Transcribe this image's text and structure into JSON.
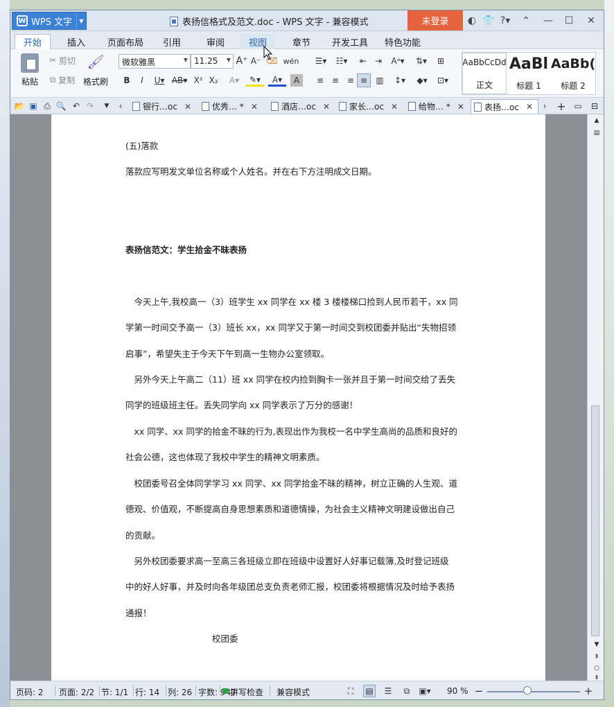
{
  "titlebar": {
    "app_name": "WPS 文字",
    "document_title": "表扬信格式及范文.doc - WPS 文字 - 兼容模式",
    "login": "未登录"
  },
  "menu": {
    "tabs": [
      "开始",
      "插入",
      "页面布局",
      "引用",
      "审阅",
      "视图",
      "章节",
      "开发工具",
      "特色功能"
    ]
  },
  "ribbon": {
    "paste": "粘贴",
    "cut": "剪切",
    "copy": "复制",
    "format_painter": "格式刷",
    "font_name": "微软雅黑",
    "font_size": "11.25",
    "styles": [
      {
        "preview": "AaBbCcDd",
        "name": "正文"
      },
      {
        "preview": "AaBl",
        "name": "标题 1"
      },
      {
        "preview": "AaBb(",
        "name": "标题 2"
      }
    ]
  },
  "doc_tabs": [
    "银行…oc",
    "优秀… *",
    "酒店…oc",
    "家长…oc",
    "给物… *",
    "表扬…oc"
  ],
  "document": {
    "lines": [
      "(五)落款",
      "落款应写明发文单位名称或个人姓名。并在右下方注明成文日期。",
      "表扬信范文：学生拾金不昧表扬",
      "　今天上午,我校高一（3）班学生 xx 同学在 xx 楼 3 楼楼梯口捡到人民币若干，xx 同",
      "学第一时间交予高一（3）班长 xx，xx 同学又于第一时间交到校团委并贴出“失物招领",
      "启事”，希望失主于今天下午到高一生物办公室领取。",
      "　另外今天上午高二（11）班 xx 同学在校内捡到胸卡一张并且于第一时间交给了丢失",
      "同学的班级班主任。丢失同学向 xx 同学表示了万分的感谢！",
      "　xx 同学、xx 同学的拾金不昧的行为,表现出作为我校一名中学生高尚的品质和良好的",
      "社会公德，这也体现了我校中学生的精神文明素质。",
      "　校团委号召全体同学学习 xx 同学、xx 同学拾金不昧的精神，树立正确的人生观、道",
      "德观、价值观，不断提高自身思想素质和道德情操，为社会主义精神文明建设做出自己",
      "的贡献。",
      "　另外校团委要求高一至高三各班级立即在班级中设置好人好事记载簿,及时登记班级",
      "中的好人好事，并及时向各年级团总支负责老师汇报，校团委将根据情况及时给予表扬",
      "通报！",
      "校团委"
    ]
  },
  "status": {
    "page_code": "页码: 2",
    "pages": "页面: 2/2",
    "section": "节: 1/1",
    "row": "行: 14",
    "col": "列: 26",
    "words": "字数: 947",
    "spell": "拼写检查",
    "compat": "兼容模式",
    "zoom": "90 %"
  }
}
